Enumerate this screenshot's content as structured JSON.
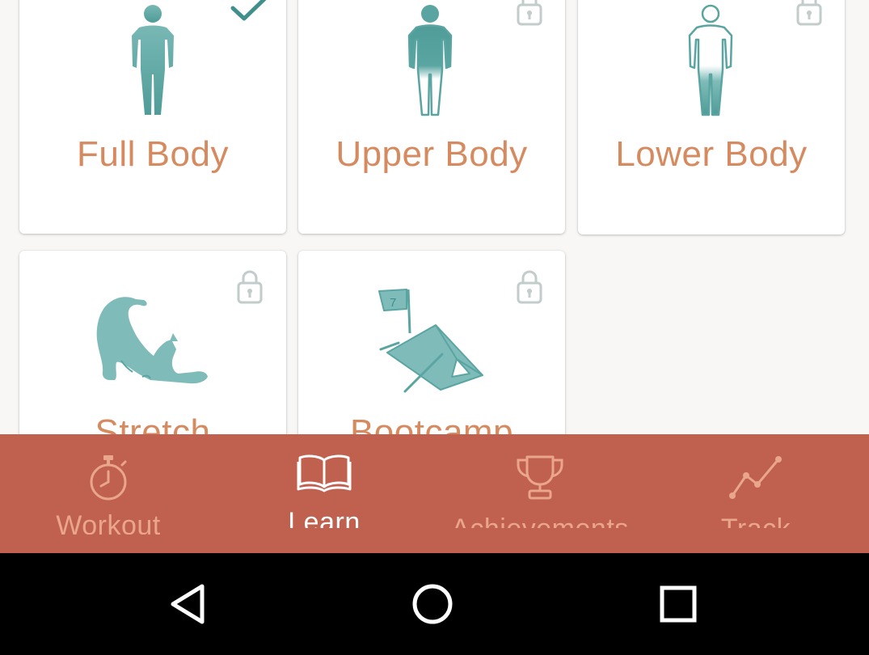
{
  "cards": [
    {
      "title": "Full Body",
      "icon": "full-body-figure-icon",
      "status": "selected"
    },
    {
      "title": "Upper Body",
      "icon": "upper-body-figure-icon",
      "status": "locked"
    },
    {
      "title": "Lower Body",
      "icon": "lower-body-figure-icon",
      "status": "locked"
    },
    {
      "title": "Stretch",
      "icon": "stretching-cat-icon",
      "status": "locked"
    },
    {
      "title": "Bootcamp",
      "icon": "tent-flag-icon",
      "status": "locked"
    }
  ],
  "bootcamp_flag_number": "7",
  "nav": {
    "items": [
      {
        "label": "Workout",
        "icon": "stopwatch-icon"
      },
      {
        "label": "Learn",
        "icon": "open-book-icon",
        "active": true
      },
      {
        "label": "Achievements",
        "icon": "trophy-icon"
      },
      {
        "label": "Track",
        "icon": "trend-line-icon"
      }
    ]
  },
  "system_nav": {
    "buttons": [
      "back-triangle-icon",
      "home-circle-icon",
      "recents-square-icon"
    ]
  },
  "colors": {
    "accent_teal": "#5aa5a2",
    "title_orange": "#d68a5f",
    "nav_background": "#c0604f",
    "nav_inactive": "#eaa68a",
    "nav_active": "#ffffff"
  }
}
